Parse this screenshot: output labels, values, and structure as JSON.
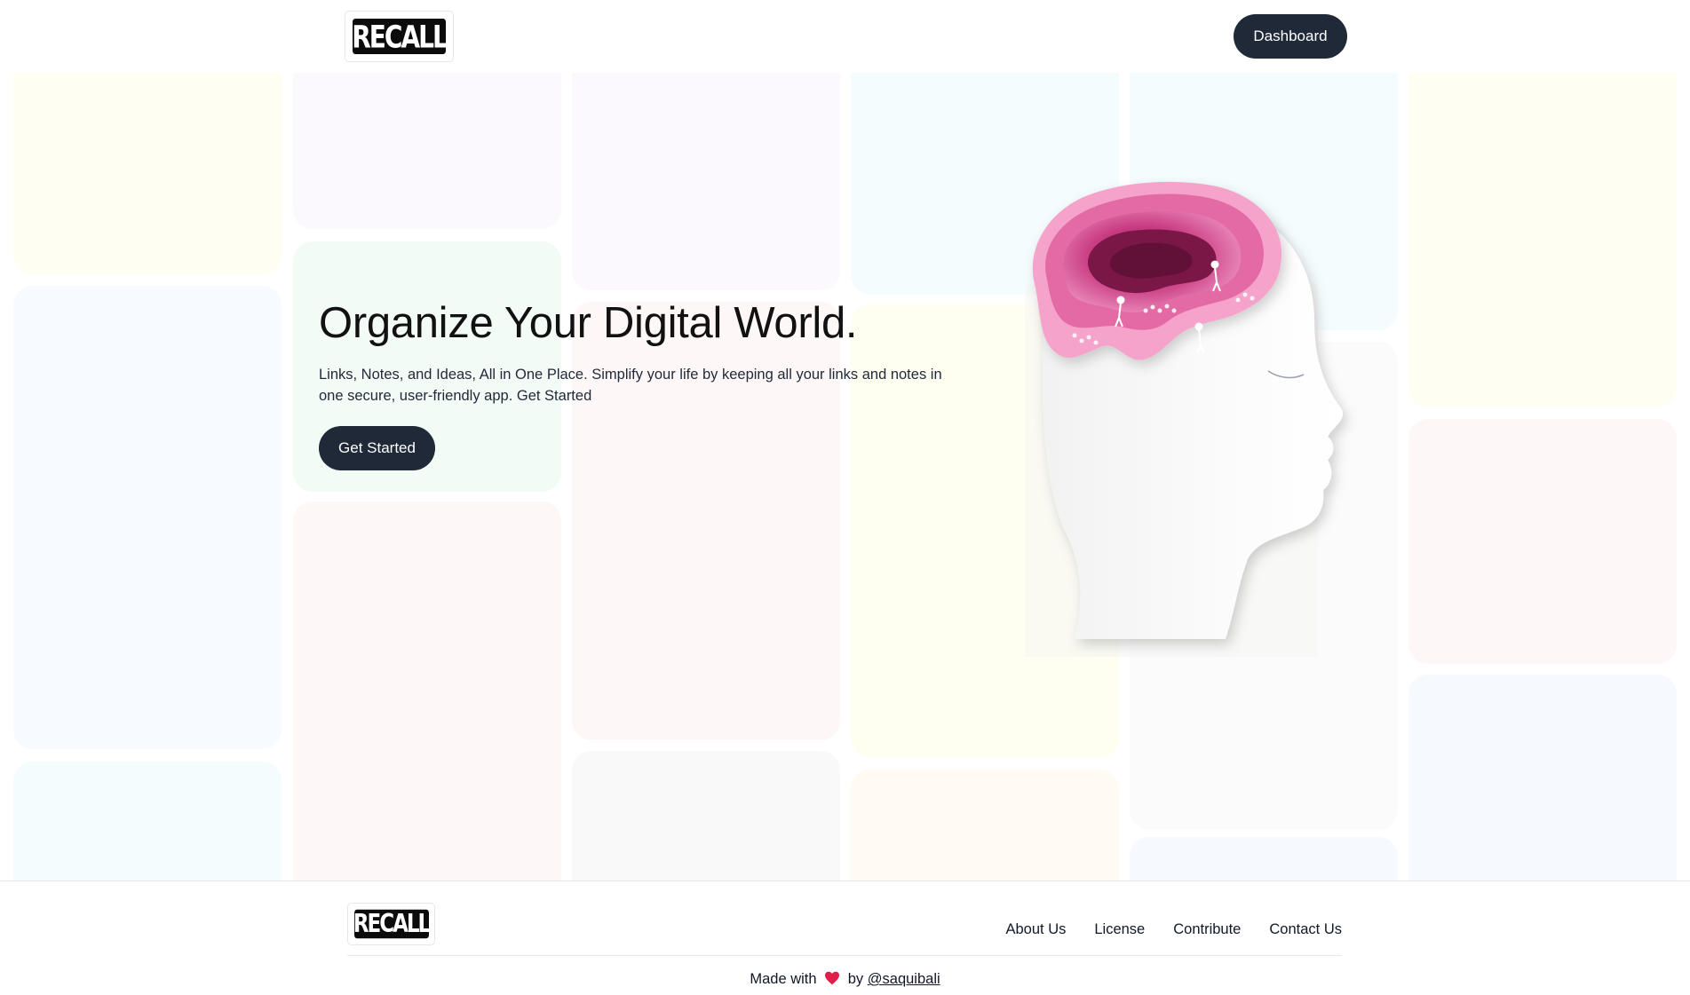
{
  "header": {
    "logo_text": "RECALL",
    "dashboard_label": "Dashboard"
  },
  "hero": {
    "title": "Organize Your Digital World.",
    "subtitle": "Links, Notes, and Ideas, All in One Place. Simplify your life by keeping all your links and notes in one secure, user-friendly app. Get Started",
    "cta_label": "Get Started"
  },
  "footer": {
    "logo_text": "RECALL",
    "nav": [
      "About Us",
      "License",
      "Contribute",
      "Contact Us"
    ],
    "made_prefix": "Made with",
    "made_by": "by",
    "handle": "@saquibali"
  },
  "colors": {
    "primary_button": "#1f2937",
    "heart": "#e11d48",
    "brain_pink": "#d9468f"
  },
  "icons": [
    "heart-icon",
    "brain-illustration"
  ]
}
